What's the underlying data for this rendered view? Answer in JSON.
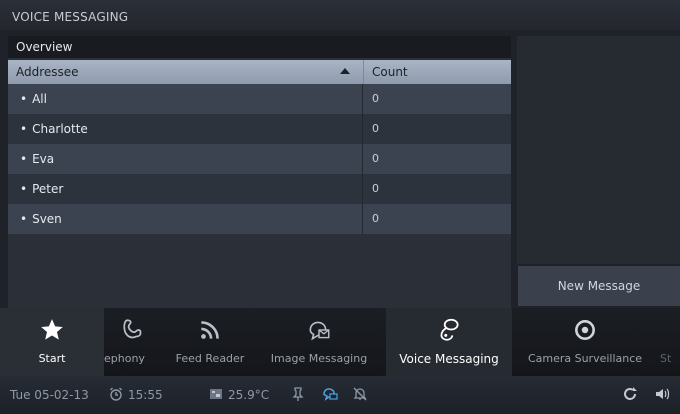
{
  "app": {
    "title": "VOICE MESSAGING"
  },
  "panel": {
    "tab_label": "Overview",
    "columns": [
      "Addressee",
      "Count"
    ],
    "rows": [
      {
        "addressee": "All",
        "count": "0"
      },
      {
        "addressee": "Charlotte",
        "count": "0"
      },
      {
        "addressee": "Eva",
        "count": "0"
      },
      {
        "addressee": "Peter",
        "count": "0"
      },
      {
        "addressee": "Sven",
        "count": "0"
      }
    ]
  },
  "actions": {
    "new_message": "New Message"
  },
  "dock": {
    "items": [
      {
        "label": "Start",
        "icon": "star-icon"
      },
      {
        "label": "ephony",
        "icon": "telephony-icon"
      },
      {
        "label": "Feed Reader",
        "icon": "feed-icon"
      },
      {
        "label": "Image Messaging",
        "icon": "image-message-icon"
      },
      {
        "label": "Voice Messaging",
        "icon": "voice-message-icon"
      },
      {
        "label": "Camera Surveillance",
        "icon": "camera-icon"
      },
      {
        "label": "St",
        "icon": ""
      }
    ]
  },
  "status": {
    "date": "Tue 05-02-13",
    "time": "15:55",
    "temperature": "25.9°C",
    "icons": [
      "alarm-clock-icon",
      "weather-icon",
      "pin-icon",
      "voice-message-indicator-icon",
      "muted-bell-icon",
      "refresh-icon",
      "volume-icon"
    ]
  },
  "colors": {
    "accent": "#4aa3df",
    "header": "#a9b4c4",
    "row_alt": "#3b4350"
  }
}
